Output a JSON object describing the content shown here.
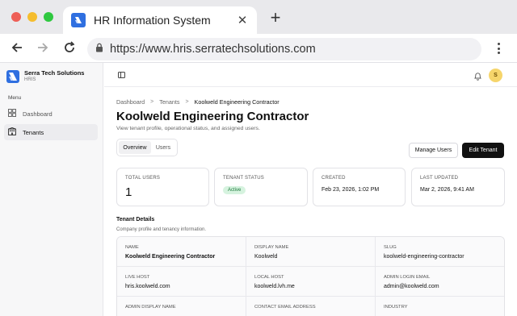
{
  "browser": {
    "tab_title": "HR Information System",
    "tab_close": "✕",
    "new_tab": "+",
    "url": "https://www.hris.serratechsolutions.com"
  },
  "brand": {
    "name": "Serra Tech Solutions",
    "sub": "HRIS",
    "color": "#2f6fe0"
  },
  "sidebar": {
    "menu_label": "Menu",
    "items": [
      {
        "label": "Dashboard",
        "icon": "dashboard-grid-icon"
      },
      {
        "label": "Tenants",
        "icon": "building-icon",
        "active": true
      }
    ]
  },
  "topbar": {
    "avatar_initial": "S",
    "avatar_color": "#f6d56b"
  },
  "breadcrumb": {
    "items": [
      "Dashboard",
      "Tenants",
      "Koolweld Engineering Contractor"
    ],
    "separator": ">"
  },
  "page": {
    "title": "Koolweld Engineering Contractor",
    "subtitle": "View tenant profile, operational status, and assigned users."
  },
  "tabs": [
    {
      "label": "Overview",
      "selected": true
    },
    {
      "label": "Users",
      "selected": false
    }
  ],
  "actions": {
    "manage_users": "Manage Users",
    "edit_tenant": "Edit Tenant"
  },
  "stats": {
    "total_users": {
      "label": "TOTAL USERS",
      "value": "1"
    },
    "status": {
      "label": "TENANT STATUS",
      "value": "Active",
      "color": "#1f7a3d"
    },
    "created": {
      "label": "CREATED",
      "value": "Feb 23, 2026, 1:02 PM"
    },
    "updated": {
      "label": "LAST UPDATED",
      "value": "Mar 2, 2026, 9:41 AM"
    }
  },
  "details": {
    "title": "Tenant Details",
    "subtitle": "Company profile and tenancy information.",
    "fields": [
      {
        "label": "NAME",
        "value": "Koolweld Engineering Contractor"
      },
      {
        "label": "DISPLAY NAME",
        "value": "Koolweld"
      },
      {
        "label": "SLUG",
        "value": "koolweld-engineering-contractor"
      },
      {
        "label": "LIVE HOST",
        "value": "hris.koolweld.com"
      },
      {
        "label": "LOCAL HOST",
        "value": "koolweld.lvh.me"
      },
      {
        "label": "ADMIN LOGIN EMAIL",
        "value": "admin@koolweld.com"
      },
      {
        "label": "ADMIN DISPLAY NAME",
        "value": ""
      },
      {
        "label": "CONTACT EMAIL ADDRESS",
        "value": ""
      },
      {
        "label": "INDUSTRY",
        "value": ""
      }
    ]
  }
}
